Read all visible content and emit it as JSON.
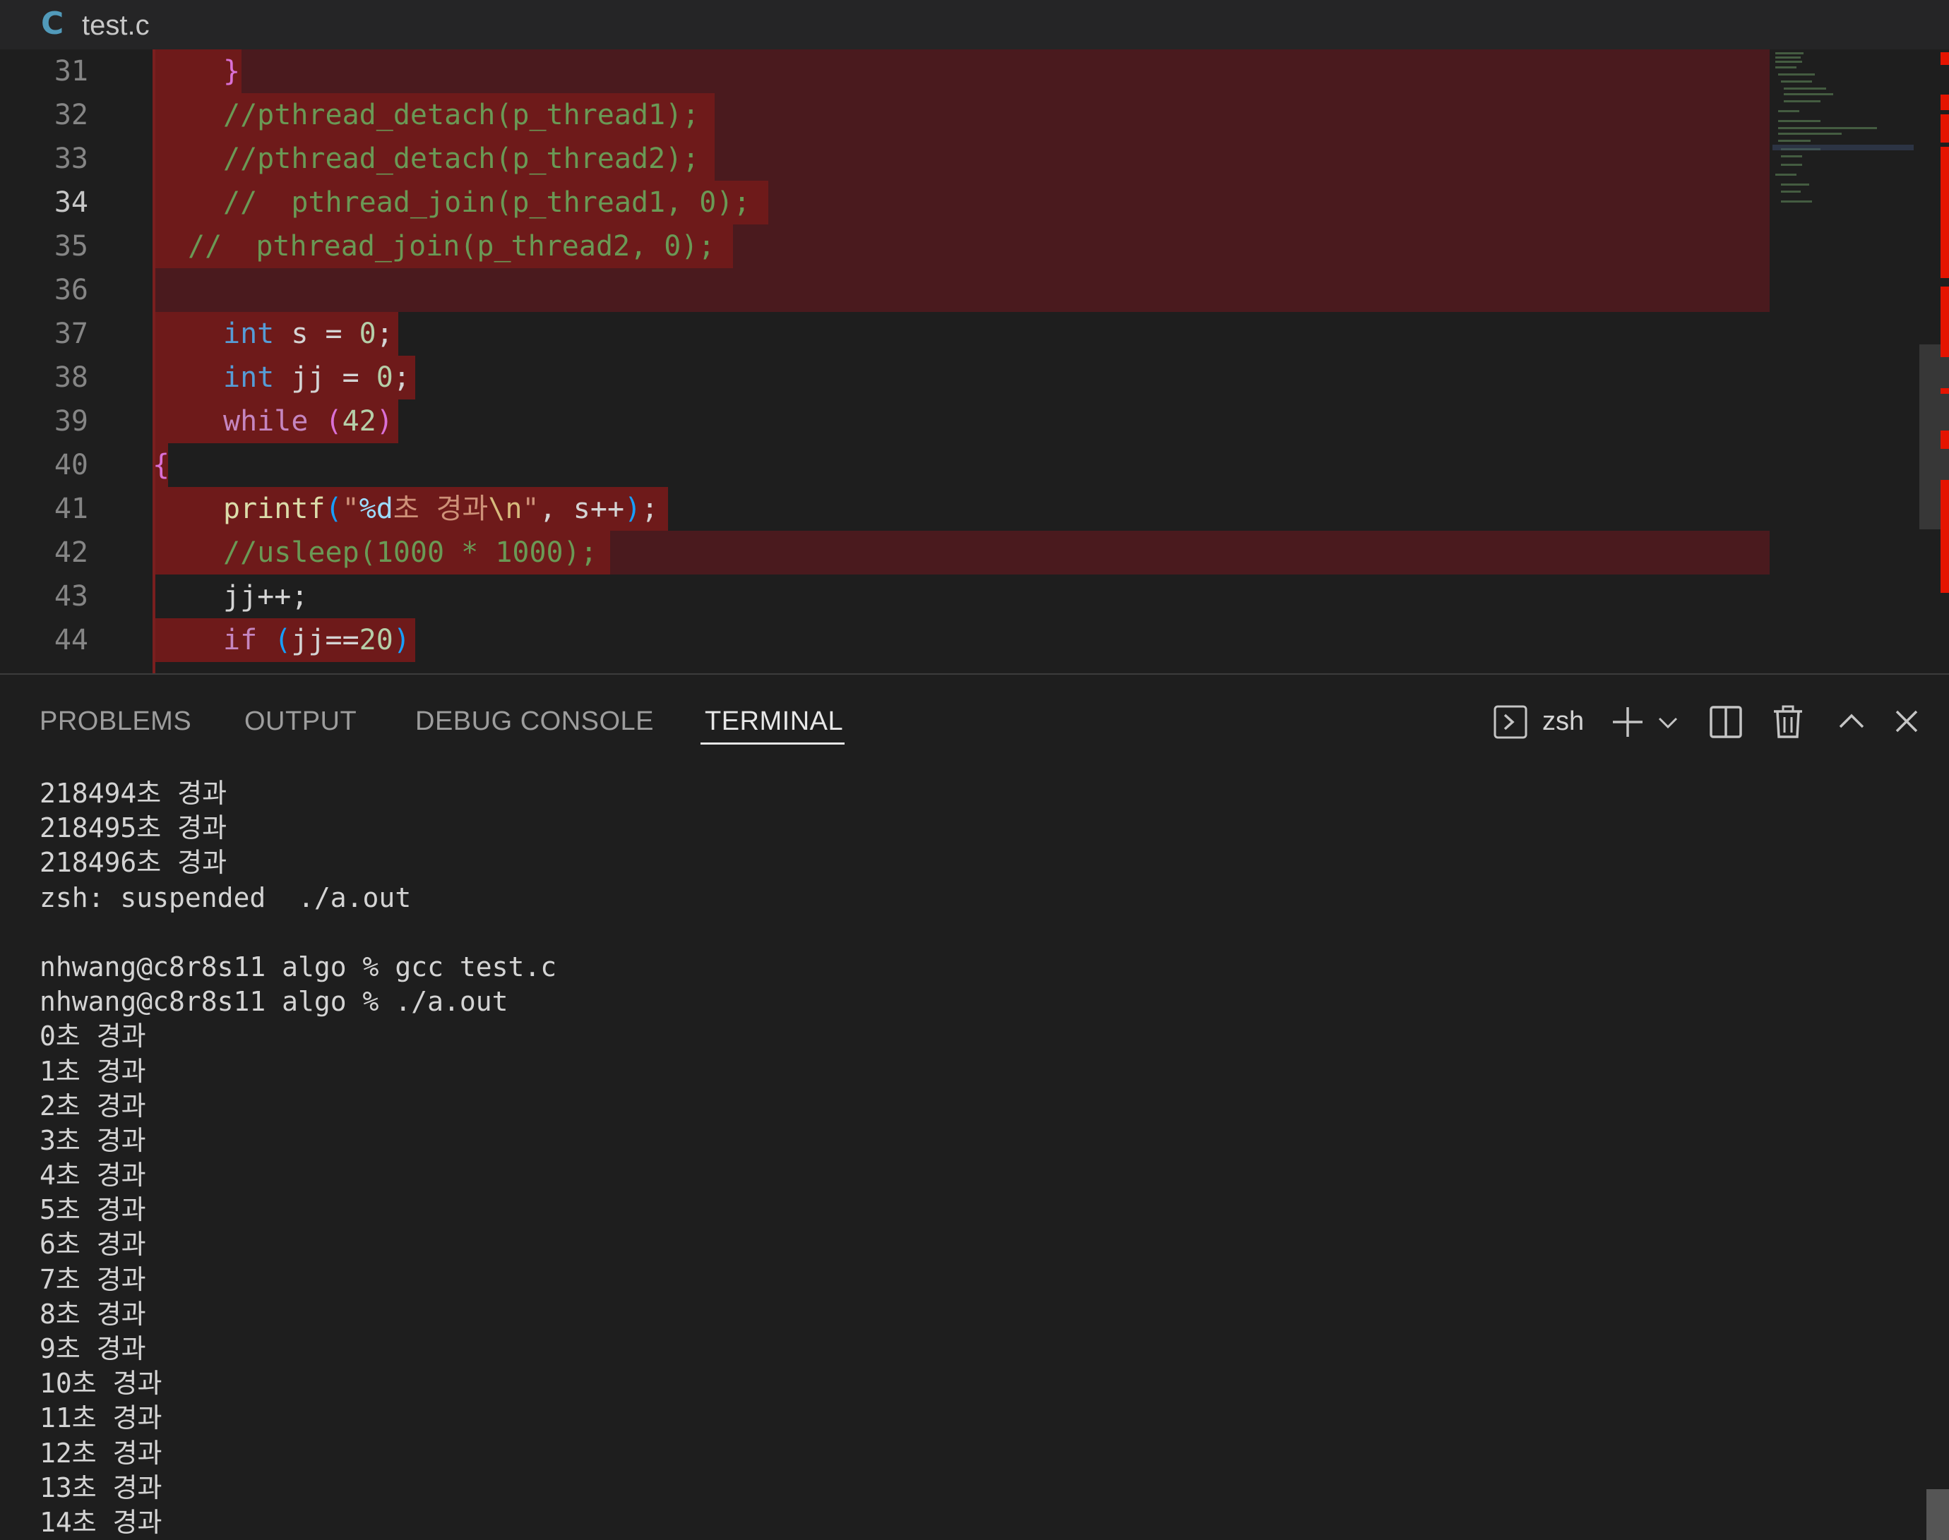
{
  "tab": {
    "icon": "C",
    "filename": "test.c"
  },
  "editor": {
    "active_line": "34",
    "lines": [
      {
        "n": "31"
      },
      {
        "n": "32"
      },
      {
        "n": "33"
      },
      {
        "n": "34"
      },
      {
        "n": "35"
      },
      {
        "n": "36"
      },
      {
        "n": "37"
      },
      {
        "n": "38"
      },
      {
        "n": "39"
      },
      {
        "n": "40"
      },
      {
        "n": "41"
      },
      {
        "n": "42"
      },
      {
        "n": "43"
      },
      {
        "n": "44"
      }
    ],
    "code": {
      "l31": "}",
      "l32": "//pthread_detach(p_thread1);",
      "l33": "//pthread_detach(p_thread2);",
      "l34": "//  pthread_join(p_thread1, 0);",
      "l35": "//  pthread_join(p_thread2, 0);",
      "l37_kw": "int",
      "l37_rest": " s = ",
      "l37_num": "0",
      "l37_end": ";",
      "l38_kw": "int",
      "l38_rest": " jj = ",
      "l38_num": "0",
      "l38_end": ";",
      "l39_kw": "while",
      "l39_open": " (",
      "l39_num": "42",
      "l39_close": ")",
      "l40": "{",
      "l41_fn": "printf",
      "l41_open": "(",
      "l41_q": "\"",
      "l41_fmt": "%d",
      "l41_str": "초 경과",
      "l41_esc": "\\n",
      "l41_q2": "\"",
      "l41_rest": ", s++",
      "l41_close": ")",
      "l41_end": ";",
      "l42": "//usleep(1000 * 1000);",
      "l43": "jj++;",
      "l44_kw": "if",
      "l44_open": " (",
      "l44_mid": "jj==",
      "l44_num": "20",
      "l44_close": ")"
    }
  },
  "panel": {
    "tabs": [
      "PROBLEMS",
      "OUTPUT",
      "DEBUG CONSOLE",
      "TERMINAL"
    ],
    "active_tab": "TERMINAL",
    "shell_name": "zsh",
    "terminal_lines": [
      "218494초 경과",
      "218495초 경과",
      "218496초 경과",
      "zsh: suspended  ./a.out",
      "",
      "nhwang@c8r8s11 algo % gcc test.c",
      "nhwang@c8r8s11 algo % ./a.out",
      "0초 경과",
      "1초 경과",
      "2초 경과",
      "3초 경과",
      "4초 경과",
      "5초 경과",
      "6초 경과",
      "7초 경과",
      "8초 경과",
      "9초 경과",
      "10초 경과",
      "11초 경과",
      "12초 경과",
      "13초 경과",
      "14초 경과"
    ]
  },
  "icons": {
    "terminal": "terminal-icon",
    "add": "plus-icon",
    "dropdown": "chevron-down-icon",
    "split": "split-terminal-icon",
    "trash": "trash-icon",
    "maximize": "chevron-up-icon",
    "close": "close-icon"
  },
  "colors": {
    "deleted_line_bg": "#4a1a1e",
    "deleted_text_bg": "#6e1a1a",
    "diff_marker": "#e51400",
    "keyword": "#569cd6",
    "control": "#c586c0",
    "comment": "#6a9955",
    "number": "#b5cea8"
  }
}
